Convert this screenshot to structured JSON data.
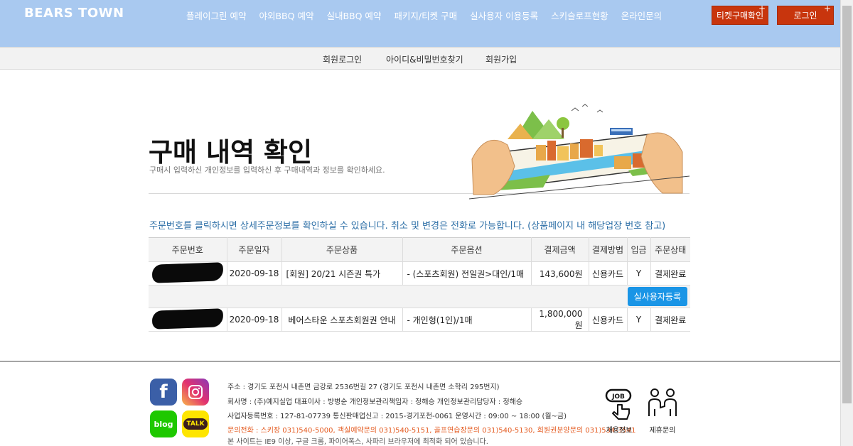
{
  "header": {
    "logo": "BEARS TOWN",
    "menu": [
      "플레이그린 예약",
      "야외BBQ 예약",
      "실내BBQ 예약",
      "패키지/티켓 구매",
      "실사용자 이용등록",
      "스키슬로프현황",
      "온라인문의"
    ],
    "ticket_check": "티켓구매확인",
    "login": "로그인",
    "plus": "+"
  },
  "subnav": [
    "회원로그인",
    "아이디&비밀번호찾기",
    "회원가입"
  ],
  "hero": {
    "title": "구매 내역 확인",
    "subtitle": "구매시 입력하신 개인정보를 입력하신 후 구매내역과 정보를 확인하세요."
  },
  "notice": "주문번호를 클릭하시면 상세주문정보를 확인하실 수 있습니다. 취소 및 변경은 전화로 가능합니다. (상품페이지 내 해당업장 번호 참고)",
  "table": {
    "headers": [
      "주문번호",
      "주문일자",
      "주문상품",
      "주문옵션",
      "결제금액",
      "결제방법",
      "입금",
      "주문상태"
    ],
    "rows": [
      {
        "date": "2020-09-18",
        "product": "[회원] 20/21 시즌권 특가",
        "option": "- (스포츠회원) 전일권>대인/1매",
        "amount": "143,600원",
        "method": "신용카드",
        "paid": "Y",
        "status": "결제완료"
      },
      {
        "date": "2020-09-18",
        "product": "베어스타운 스포츠회원권 안내",
        "option": "- 개인형(1인)/1매",
        "amount": "1,800,000원",
        "method": "신용카드",
        "paid": "Y",
        "status": "결제완료"
      }
    ],
    "register_button": "실사용자등록"
  },
  "footer": {
    "address": "주소 : 경기도 포천시 내촌면 금강로 2536번길 27 (경기도 포천시 내촌면 소학리 295번지)",
    "company": "회사명 : (주)예지실업     대표이사 : 방병순     개인정보관리책임자 : 정해승     개인정보관리담당자 : 정해승",
    "business": "사업자등록번호 : 127-81-07739     통신판매업신고 : 2015-경기포천-0061     운영시간 : 09:00 ~ 18:00 (월~금)",
    "contact": "문의전화 : 스키장 031)540-5000, 객실예약문의 031)540-5151, 골프연습장문의 031)540-5130, 회원권분양문의 031)534-3541",
    "browser": "본 사이트는 IE9 이상, 구글 크롬, 파이어폭스, 사파리 브라우저에 최적화 되어 있습니다.",
    "social": {
      "facebook": "f",
      "blog": "blog",
      "talk": "TALK"
    },
    "jobs_label": "채용정보",
    "partner_label": "제휴문의",
    "job_icon_text": "JOB"
  }
}
